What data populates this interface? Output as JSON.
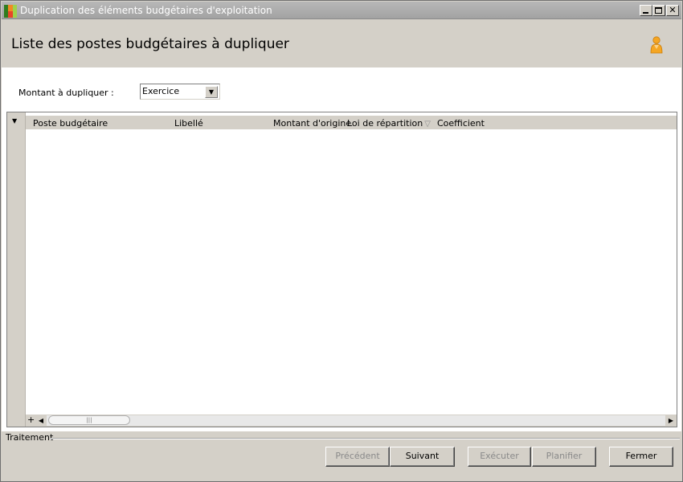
{
  "window": {
    "title": "Duplication des éléments budgétaires d'exploitation"
  },
  "header": {
    "title": "Liste des postes budgétaires à dupliquer",
    "user_icon": "person-icon"
  },
  "filter": {
    "label": "Montant à dupliquer :",
    "selected": "Exercice"
  },
  "grid": {
    "columns": [
      "Poste budgétaire",
      "Libellé",
      "Montant d'origine",
      "Loi de répartition",
      "Coefficient"
    ],
    "rows": [],
    "add_label": "+",
    "thumb_grip": "|||"
  },
  "footer": {
    "group_label": "Traitement",
    "buttons": {
      "previous": "Précédent",
      "next": "Suivant",
      "execute": "Exécuter",
      "schedule": "Planifier",
      "close": "Fermer"
    }
  },
  "colors": {
    "chrome": "#d4d0c8",
    "titlebar": "#a2a2a2",
    "disabled_text": "#8a8a8a"
  }
}
